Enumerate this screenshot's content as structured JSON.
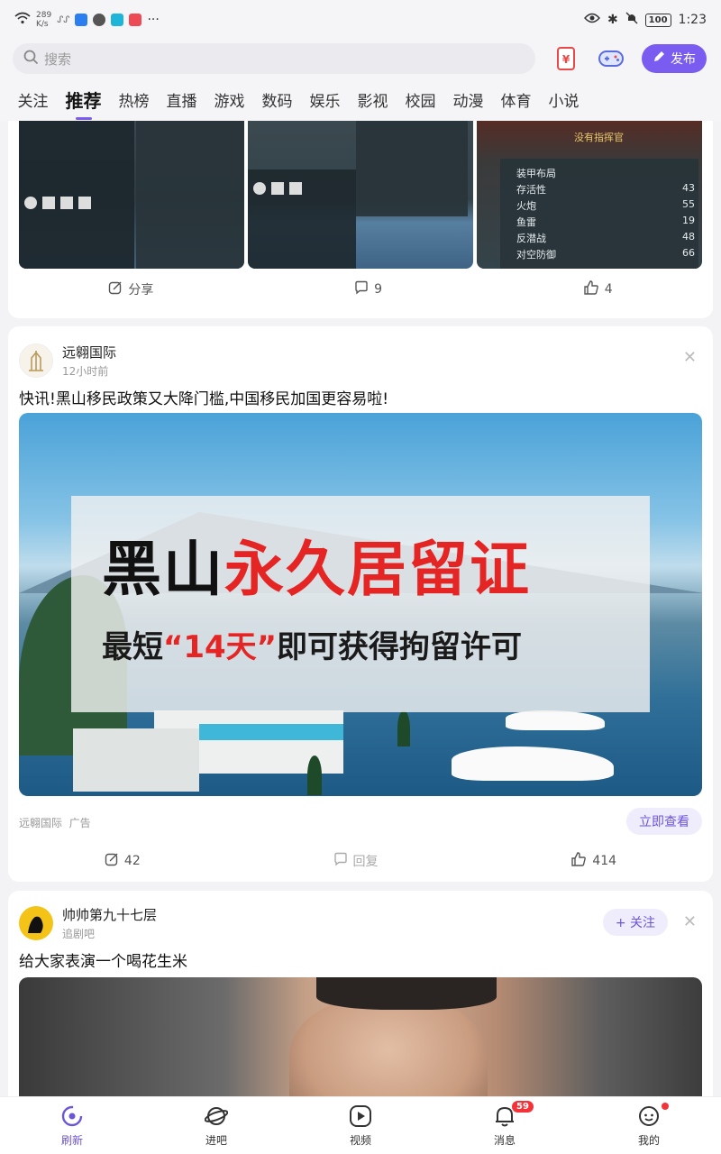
{
  "status_bar": {
    "net_speed_value": "289",
    "net_speed_unit": "K/s",
    "battery": "100",
    "time": "1:23"
  },
  "header": {
    "search_placeholder": "搜索",
    "publish_label": "发布"
  },
  "tabs": [
    "关注",
    "推荐",
    "热榜",
    "直播",
    "游戏",
    "数码",
    "娱乐",
    "影视",
    "校园",
    "动漫",
    "体育",
    "小说"
  ],
  "active_tab": "推荐",
  "post1": {
    "shot_stats": [
      "装甲布局",
      "存活性",
      "火炮",
      "鱼雷",
      "反潜战",
      "对空防御"
    ],
    "shot_values": [
      "43",
      "55",
      "19",
      "48",
      "66"
    ],
    "no_commander": "没有指挥官",
    "share_label": "分享",
    "comments": "9",
    "likes": "4"
  },
  "post2": {
    "author": "远翱国际",
    "time": "12小时前",
    "title": "快讯!黑山移民政策又大降门槛,中国移民加国更容易啦!",
    "banner_title_black": "黑山",
    "banner_title_red": "永久居留证",
    "banner_sub_a": "最短",
    "banner_sub_red": "“14天”",
    "banner_sub_b": "即可获得拘留许可",
    "ad_source": "远翱国际",
    "ad_tag": "广告",
    "cta": "立即查看",
    "shares": "42",
    "reply_label": "回复",
    "likes": "414"
  },
  "post3": {
    "author": "帅帅第九十七层",
    "forum": "追剧吧",
    "follow_label": "+ 关注",
    "title": "给大家表演一个喝花生米"
  },
  "bottom_nav": {
    "items": [
      "刷新",
      "进吧",
      "视频",
      "消息",
      "我的"
    ],
    "message_badge": "59"
  },
  "colors": {
    "accent": "#7a5cf0",
    "badge": "#f2333a",
    "banner_red": "#e52424"
  }
}
